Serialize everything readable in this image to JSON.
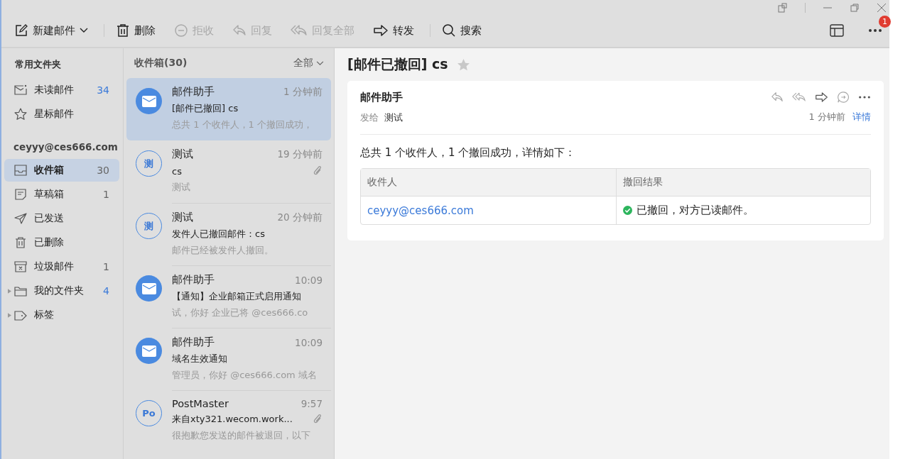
{
  "toolbar": {
    "items": [
      {
        "kind": "compose",
        "label": "新建邮件",
        "disabled": false,
        "dropdown": true
      },
      {
        "kind": "delete",
        "label": "删除",
        "disabled": false,
        "dropdown": false
      },
      {
        "kind": "reject",
        "label": "拒收",
        "disabled": true,
        "dropdown": false
      },
      {
        "kind": "reply",
        "label": "回复",
        "disabled": true,
        "dropdown": false
      },
      {
        "kind": "reply_all",
        "label": "回复全部",
        "disabled": true,
        "dropdown": false
      },
      {
        "kind": "forward",
        "label": "转发",
        "disabled": false,
        "dropdown": false
      },
      {
        "kind": "search",
        "label": "搜索",
        "disabled": false,
        "dropdown": false
      }
    ],
    "notification_badge": "1"
  },
  "sidebar": {
    "common_heading": "常用文件夹",
    "common": [
      {
        "label": "未读邮件",
        "count": "34",
        "count_emphasis": true,
        "selected": false,
        "expandable": false
      },
      {
        "label": "星标邮件",
        "selected": false,
        "expandable": false
      }
    ],
    "account": "ceyyy@ces666.com",
    "folders": [
      {
        "label": "收件箱",
        "count": "30",
        "count_emphasis": false,
        "selected": true,
        "expandable": false
      },
      {
        "label": "草稿箱",
        "count": "1",
        "count_emphasis": false,
        "selected": false,
        "expandable": false
      },
      {
        "label": "已发送",
        "selected": false,
        "expandable": false
      },
      {
        "label": "已删除",
        "selected": false,
        "expandable": false
      },
      {
        "label": "垃圾邮件",
        "count": "1",
        "count_emphasis": false,
        "selected": false,
        "expandable": false
      },
      {
        "label": "我的文件夹",
        "count": "4",
        "count_emphasis": true,
        "selected": false,
        "expandable": true
      },
      {
        "label": "标签",
        "selected": false,
        "expandable": true
      }
    ]
  },
  "message_list": {
    "title": "收件箱(30)",
    "filter": "全部",
    "messages": [
      {
        "avatar": {
          "kind": "envelope"
        },
        "sender": "邮件助手",
        "time": "1 分钟前",
        "subject": "[邮件已撤回] cs",
        "preview": "总共 1 个收件人，1 个撤回成功，",
        "attachment": false,
        "selected": true
      },
      {
        "avatar": {
          "kind": "text",
          "text": "测"
        },
        "sender": "测试",
        "time": "19 分钟前",
        "subject": "cs",
        "preview": "测试",
        "attachment": true,
        "selected": false
      },
      {
        "avatar": {
          "kind": "text",
          "text": "测"
        },
        "sender": "测试",
        "time": "20 分钟前",
        "subject": "发件人已撤回邮件：cs",
        "preview": "邮件已经被发件人撤回。",
        "attachment": false,
        "selected": false
      },
      {
        "avatar": {
          "kind": "envelope"
        },
        "sender": "邮件助手",
        "time": "10:09",
        "subject": "【通知】企业邮箱正式启用通知",
        "preview": "试，你好 企业已将 @ces666.co",
        "attachment": false,
        "selected": false
      },
      {
        "avatar": {
          "kind": "envelope"
        },
        "sender": "邮件助手",
        "time": "10:09",
        "subject": "域名生效通知",
        "preview": "管理员，你好 @ces666.com 域名",
        "attachment": false,
        "selected": false
      },
      {
        "avatar": {
          "kind": "text",
          "text": "Po"
        },
        "sender": "PostMaster",
        "time": "9:57",
        "subject": "来自xty321.wecom.work...",
        "preview": "很抱歉您发送的邮件被退回，以下",
        "attachment": true,
        "selected": false
      }
    ]
  },
  "reader": {
    "subject": "[邮件已撤回] cs",
    "starred": false,
    "sender": "邮件助手",
    "to_label": "发给",
    "to": "测试",
    "time": "1 分钟前",
    "details_link": "详情",
    "body": "总共 1 个收件人，1 个撤回成功，详情如下：",
    "table": {
      "columns": [
        "收件人",
        "撤回结果"
      ],
      "rows": [
        {
          "recipient": "ceyyy@ces666.com",
          "result": "已撤回，对方已读邮件。",
          "success": true
        }
      ]
    }
  }
}
